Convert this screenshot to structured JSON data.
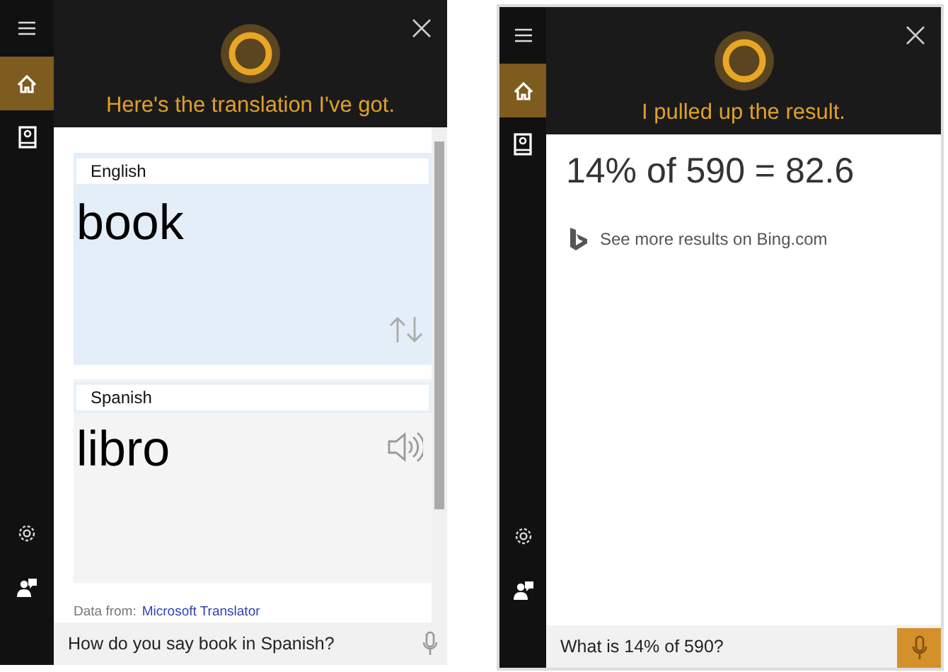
{
  "panels": [
    {
      "sidebar": {
        "top_items": [
          {
            "kind": "menu",
            "selected": false
          },
          {
            "kind": "home",
            "selected": true
          },
          {
            "kind": "notebook",
            "selected": false
          }
        ],
        "bottom_items": [
          {
            "kind": "settings",
            "selected": false
          },
          {
            "kind": "feedback",
            "selected": false
          }
        ]
      },
      "header": {
        "message": "Here's the translation I've got."
      },
      "content": {
        "kind": "translation",
        "source": {
          "language": "English",
          "text": "book"
        },
        "target": {
          "language": "Spanish",
          "text": "libro"
        },
        "attribution": {
          "prefix": "Data from:",
          "link": "Microsoft Translator"
        }
      },
      "scrollbar": true,
      "search": {
        "value": "How do you say book in Spanish?",
        "mic": {
          "kind": "plain"
        }
      }
    },
    {
      "sidebar": {
        "top_items": [
          {
            "kind": "menu",
            "selected": false
          },
          {
            "kind": "home",
            "selected": true
          },
          {
            "kind": "notebook",
            "selected": false
          }
        ],
        "bottom_items": [
          {
            "kind": "settings",
            "selected": false
          },
          {
            "kind": "feedback",
            "selected": false
          }
        ]
      },
      "header": {
        "message": "I pulled up the result."
      },
      "content": {
        "kind": "result",
        "result": "14% of 590 = 82.6",
        "link": "See more results on Bing.com"
      },
      "scrollbar": false,
      "search": {
        "value": "What is 14% of 590?",
        "mic": {
          "kind": "filled"
        }
      }
    }
  ]
}
